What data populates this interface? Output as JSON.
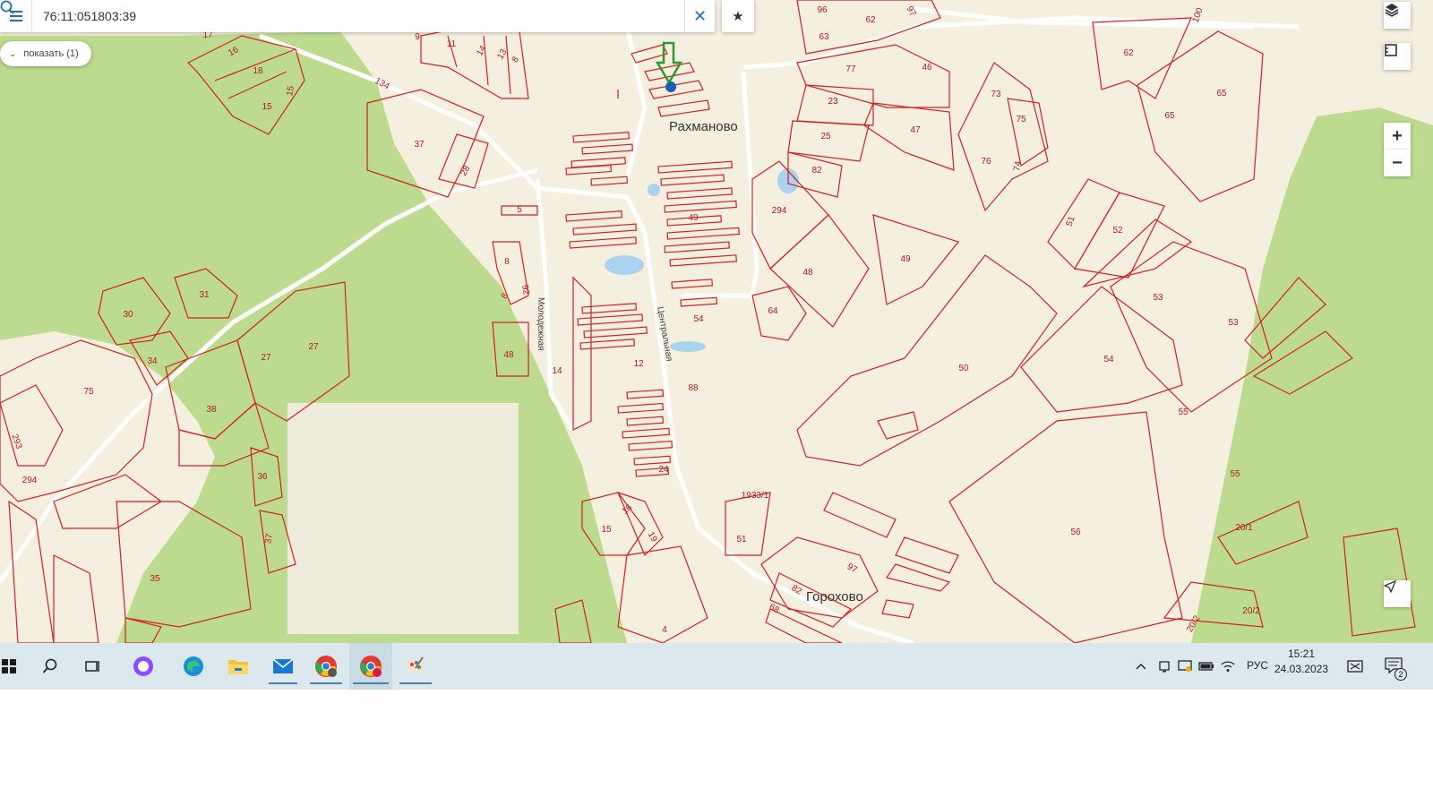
{
  "search": {
    "value": "76:11:051803:39",
    "menu_icon": "hamburger-menu-icon",
    "search_icon": "search-icon",
    "clear_icon": "close-icon"
  },
  "bookmark": {
    "icon": "star-icon"
  },
  "show_button": {
    "label": "показать (1)",
    "icon": "chevron-down-icon"
  },
  "map_controls": {
    "layers_icon": "layers-icon",
    "ruler_icon": "measure-icon",
    "zoom_in": "+",
    "zoom_out": "−",
    "locate_icon": "navigation-arrow-icon"
  },
  "colors": {
    "land": "#f4efde",
    "forest": "#bcdb8e",
    "parcel_border": "#d42020",
    "water": "#a9d3ef",
    "road": "#ffffff",
    "marker_arrow": "#2e9a2e",
    "marker_dot": "#1a5fb4"
  },
  "map": {
    "villages": [
      "Рахманово",
      "Горохово"
    ],
    "streets": [
      "Молодежная",
      "Центральная"
    ],
    "road_number": "134",
    "parcels": [
      {
        "label": "96"
      },
      {
        "label": "62"
      },
      {
        "label": "97"
      },
      {
        "label": "63"
      },
      {
        "label": "100"
      },
      {
        "label": "62"
      },
      {
        "label": "17"
      },
      {
        "label": "16"
      },
      {
        "label": "9"
      },
      {
        "label": "11"
      },
      {
        "label": "14"
      },
      {
        "label": "13"
      },
      {
        "label": "8"
      },
      {
        "label": "18"
      },
      {
        "label": "15"
      },
      {
        "label": "15"
      },
      {
        "label": "77"
      },
      {
        "label": "46"
      },
      {
        "label": "73"
      },
      {
        "label": "65"
      },
      {
        "label": "23"
      },
      {
        "label": "75"
      },
      {
        "label": "65"
      },
      {
        "label": "25"
      },
      {
        "label": "47"
      },
      {
        "label": "37"
      },
      {
        "label": "76"
      },
      {
        "label": "74"
      },
      {
        "label": "28"
      },
      {
        "label": "82"
      },
      {
        "label": "294"
      },
      {
        "label": "5"
      },
      {
        "label": "49"
      },
      {
        "label": "51"
      },
      {
        "label": "52"
      },
      {
        "label": "49"
      },
      {
        "label": "8"
      },
      {
        "label": "48"
      },
      {
        "label": "8"
      },
      {
        "label": "92"
      },
      {
        "label": "31"
      },
      {
        "label": "53"
      },
      {
        "label": "30"
      },
      {
        "label": "64"
      },
      {
        "label": "54"
      },
      {
        "label": "53"
      },
      {
        "label": "27"
      },
      {
        "label": "27"
      },
      {
        "label": "48"
      },
      {
        "label": "34"
      },
      {
        "label": "54"
      },
      {
        "label": "14"
      },
      {
        "label": "12"
      },
      {
        "label": "50"
      },
      {
        "label": "75"
      },
      {
        "label": "88"
      },
      {
        "label": "38"
      },
      {
        "label": "55"
      },
      {
        "label": "293"
      },
      {
        "label": "294"
      },
      {
        "label": "36"
      },
      {
        "label": "24"
      },
      {
        "label": "55"
      },
      {
        "label": "1933/1"
      },
      {
        "label": "16"
      },
      {
        "label": "20/1"
      },
      {
        "label": "15"
      },
      {
        "label": "19"
      },
      {
        "label": "56"
      },
      {
        "label": "51"
      },
      {
        "label": "37"
      },
      {
        "label": "97"
      },
      {
        "label": "35"
      },
      {
        "label": "82"
      },
      {
        "label": "20/2"
      },
      {
        "label": "68"
      },
      {
        "label": "4"
      },
      {
        "label": "20/2"
      }
    ]
  },
  "taskbar": {
    "apps": [
      {
        "name": "start",
        "icon": "windows-start-icon"
      },
      {
        "name": "search",
        "icon": "search-icon"
      },
      {
        "name": "task-view",
        "icon": "task-view-icon"
      },
      {
        "name": "alice",
        "icon": "alice-assistant-icon"
      },
      {
        "name": "edge",
        "icon": "edge-browser-icon"
      },
      {
        "name": "explorer",
        "icon": "file-explorer-icon"
      },
      {
        "name": "mail",
        "icon": "mail-icon"
      },
      {
        "name": "chrome-1",
        "icon": "chrome-icon"
      },
      {
        "name": "chrome-2",
        "icon": "chrome-icon"
      },
      {
        "name": "paint",
        "icon": "paint-icon"
      }
    ],
    "tray": {
      "language": "РУС",
      "time": "15:21",
      "date": "24.03.2023",
      "notifications_count": "2"
    }
  }
}
